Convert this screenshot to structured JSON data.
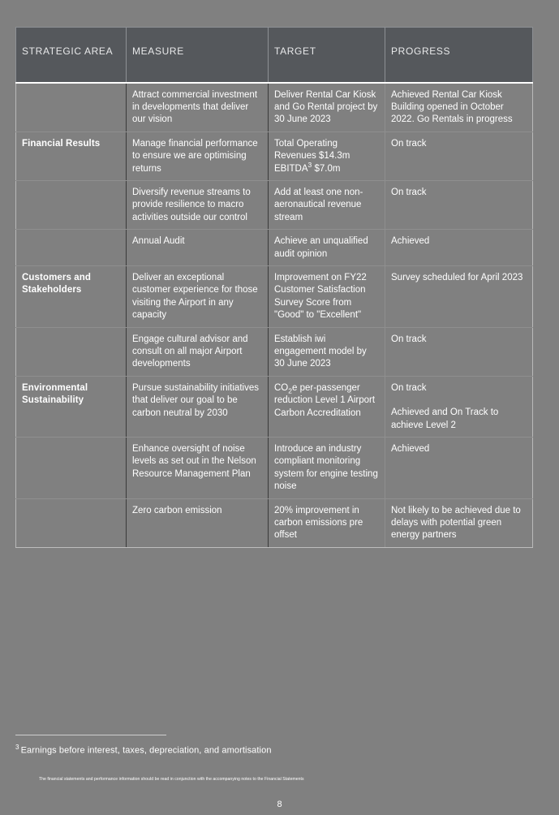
{
  "table": {
    "columns": [
      "STRATEGIC AREA",
      "MEASURE",
      "TARGET",
      "PROGRESS"
    ],
    "rows": [
      {
        "area": "",
        "measure": "Attract commercial investment in developments that deliver our vision",
        "target": "Deliver Rental Car Kiosk and Go Rental project by 30 June 2023",
        "progress": "Achieved Rental Car Kiosk Building opened in October 2022. Go Rentals in progress",
        "group_start": false
      },
      {
        "area": "Financial Results",
        "measure": "Manage financial performance to ensure we are optimising returns",
        "target_lines": [
          "Total Operating Revenues $14.3m",
          "EBITDA",
          " $7.0m"
        ],
        "target_marker": "3",
        "progress": "On track",
        "group_start": true
      },
      {
        "area": "",
        "measure": "Diversify revenue streams to provide resilience to macro activities outside our control",
        "target": "Add at least one non-aeronautical revenue stream",
        "progress": "On track",
        "group_start": false
      },
      {
        "area": "",
        "measure": "Annual Audit",
        "target": "Achieve an unqualified audit opinion",
        "progress": "Achieved",
        "group_start": false
      },
      {
        "area": "Customers and Stakeholders",
        "measure": "Deliver an exceptional customer experience for those visiting the Airport in any capacity",
        "target": "Improvement on FY22 Customer Satisfaction Survey Score from \"Good\" to \"Excellent\"",
        "progress": "Survey scheduled for April 2023",
        "group_start": true
      },
      {
        "area": "",
        "measure": "Engage cultural advisor and consult on all major Airport developments",
        "target": "Establish iwi engagement model by 30 June 2023",
        "progress": "On track",
        "group_start": false
      },
      {
        "area": "Environmental Sustainability",
        "measure": "Pursue sustainability initiatives that deliver our goal to be carbon neutral by 2030",
        "target_co2": {
          "prefix": "CO",
          "subscript": "2",
          "suffix": "e per-passenger reduction"
        },
        "target_extra": "Level 1 Airport Carbon Accreditation",
        "progress_lines": [
          "On track",
          "Achieved and On Track to achieve Level 2"
        ],
        "group_start": true
      },
      {
        "area": "",
        "measure": "Enhance oversight of noise levels as set out in the Nelson Resource Management Plan",
        "target": "Introduce an industry compliant monitoring system for engine testing noise",
        "progress": "Achieved",
        "group_start": false
      },
      {
        "area": "",
        "measure": "Zero carbon emission",
        "target": "20% improvement in carbon emissions pre offset",
        "progress": "Not likely to be achieved due to delays with potential green energy partners",
        "group_start": false
      }
    ]
  },
  "footnote": {
    "marker": "3",
    "text": "Earnings before interest, taxes, depreciation, and amortisation"
  },
  "fineprint": "The financial statements and performance information should be read in conjunction with the accompanying notes to the Financial Statements",
  "page_number": "8",
  "colors": {
    "page_background": "#808080",
    "header_background": "#55585c",
    "text": "#ffffff",
    "grid_line": "#8f8f8f"
  }
}
